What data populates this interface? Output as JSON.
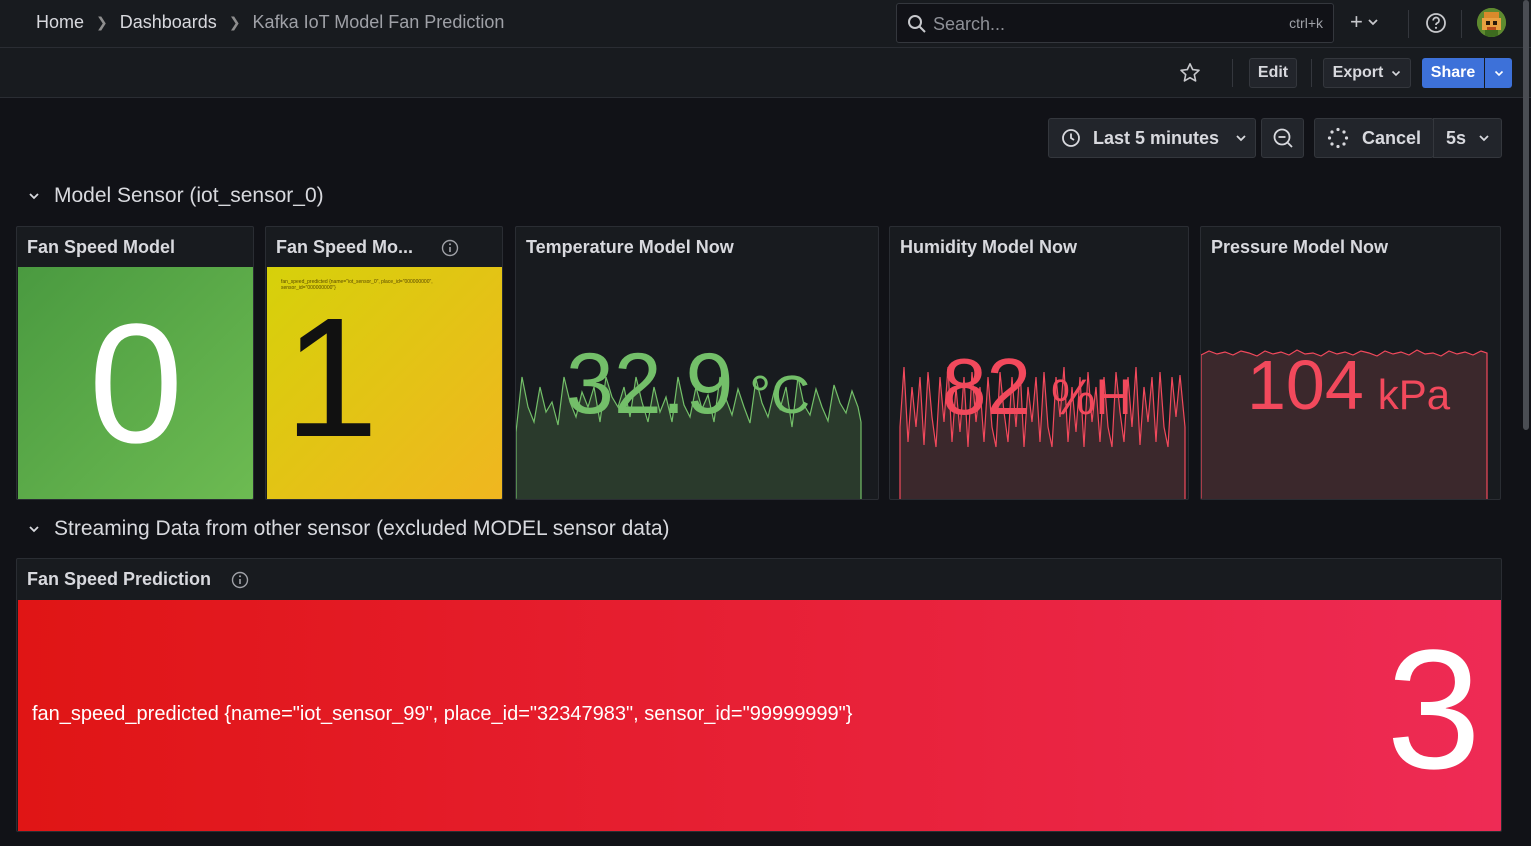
{
  "breadcrumb": {
    "home": "Home",
    "dashboards": "Dashboards",
    "current": "Kafka IoT Model Fan Prediction"
  },
  "search": {
    "placeholder": "Search...",
    "shortcut": "ctrl+k"
  },
  "toolbar": {
    "edit_label": "Edit",
    "export_label": "Export",
    "share_label": "Share"
  },
  "timepicker": {
    "range_label": "Last 5 minutes",
    "cancel_label": "Cancel",
    "refresh_interval": "5s"
  },
  "rows": [
    {
      "title": "Model Sensor (iot_sensor_0)"
    },
    {
      "title": "Streaming Data from other sensor (excluded MODEL sensor data)"
    }
  ],
  "panels": {
    "fan_speed_model": {
      "title": "Fan Speed Model",
      "value": "0",
      "color": "#5aa64b"
    },
    "fan_speed_model_2": {
      "title": "Fan Speed Mo...",
      "value": "1",
      "legend": "fan_speed_predicted {name=\"iot_sensor_0\", place_id=\"000000000\", sensor_id=\"000000000\"}",
      "color": "#e0c400"
    },
    "temperature": {
      "title": "Temperature Model Now",
      "value": "32.9",
      "unit": "°C",
      "color": "#73bf69"
    },
    "humidity": {
      "title": "Humidity Model Now",
      "value": "82",
      "unit": "%H",
      "color": "#f2495c"
    },
    "pressure": {
      "title": "Pressure Model Now",
      "value": "104",
      "unit": "kPa",
      "color": "#f2495c"
    },
    "fan_speed_prediction": {
      "title": "Fan Speed Prediction",
      "label": "fan_speed_predicted {name=\"iot_sensor_99\", place_id=\"32347983\", sensor_id=\"99999999\"}",
      "value": "3",
      "color": "#e0252f"
    }
  },
  "icons": [
    "search-icon",
    "plus-icon",
    "chevron-down-icon",
    "help-icon",
    "avatar",
    "star-icon",
    "clock-icon",
    "zoom-out-icon",
    "spinner-icon",
    "info-icon"
  ]
}
